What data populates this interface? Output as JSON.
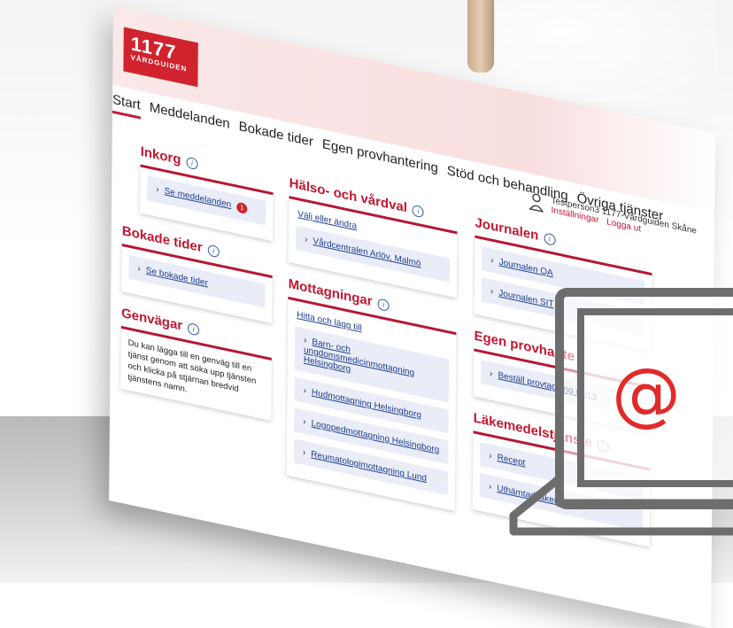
{
  "header": {
    "logo_number": "1177",
    "logo_name": "VÅRDGUIDEN"
  },
  "nav": {
    "items": [
      {
        "label": "Start"
      },
      {
        "label": "Meddelanden"
      },
      {
        "label": "Bokade tider"
      },
      {
        "label": "Egen provhantering"
      },
      {
        "label": "Stöd och behandling"
      },
      {
        "label": "Övriga tjänster"
      }
    ]
  },
  "user": {
    "name": "Testperson3 1177-Vårdguiden Skåne",
    "settings": "Inställningar",
    "logout": "Logga ut"
  },
  "inkorg": {
    "title": "Inkorg",
    "link": "Se meddelanden",
    "badge": "1"
  },
  "bokade": {
    "title": "Bokade tider",
    "link": "Se bokade tider"
  },
  "genvagar": {
    "title": "Genvägar",
    "text": "Du kan lägga till en genväg till en tjänst genom att söka upp tjänsten och klicka på stjärnan bredvid tjänstens namn."
  },
  "halso": {
    "title": "Hälso- och vårdval",
    "top_link": "Välj eller ändra",
    "link": "Vårdcentralen Arlöv, Malmö"
  },
  "mottagningar": {
    "title": "Mottagningar",
    "top_link": "Hitta och lägg till",
    "links": [
      "Barn- och ungdomsmedicinmottagning Helsingborg",
      "Hudmottagning Helsingborg",
      "Logopedmottagning Helsingborg",
      "Reumatologimottagning Lund"
    ]
  },
  "journalen": {
    "title": "Journalen",
    "links": [
      "Journalen QA",
      "Journalen SIT"
    ]
  },
  "egen": {
    "title": "Egen provhante",
    "link": "Beställ provtagning och s"
  },
  "lakemedel": {
    "title": "Läkemedelstjänste",
    "links": [
      "Recept",
      "Uthämtad läkemedel"
    ]
  },
  "laptop": {
    "symbol": "@"
  },
  "colors": {
    "brand": "#d1232d",
    "accent": "#c2162f",
    "link": "#1d3e8f"
  }
}
